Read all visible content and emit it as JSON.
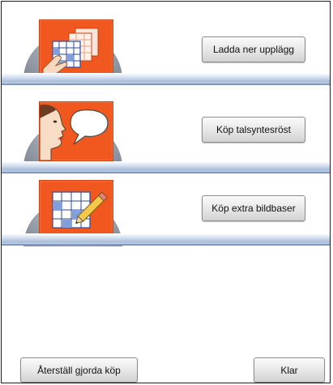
{
  "purchases": [
    {
      "icon": "layout-download-icon",
      "button_label": "Ladda ner upplägg"
    },
    {
      "icon": "speaking-face-icon",
      "button_label": "Köp talsyntesröst"
    },
    {
      "icon": "picture-edit-icon",
      "button_label": "Köp extra bildbaser"
    }
  ],
  "footer": {
    "restore_label": "Återställ gjorda köp",
    "done_label": "Klar"
  },
  "colors": {
    "tile_orange": "#f0581f",
    "shelf_blue": "#a9bcd9"
  }
}
